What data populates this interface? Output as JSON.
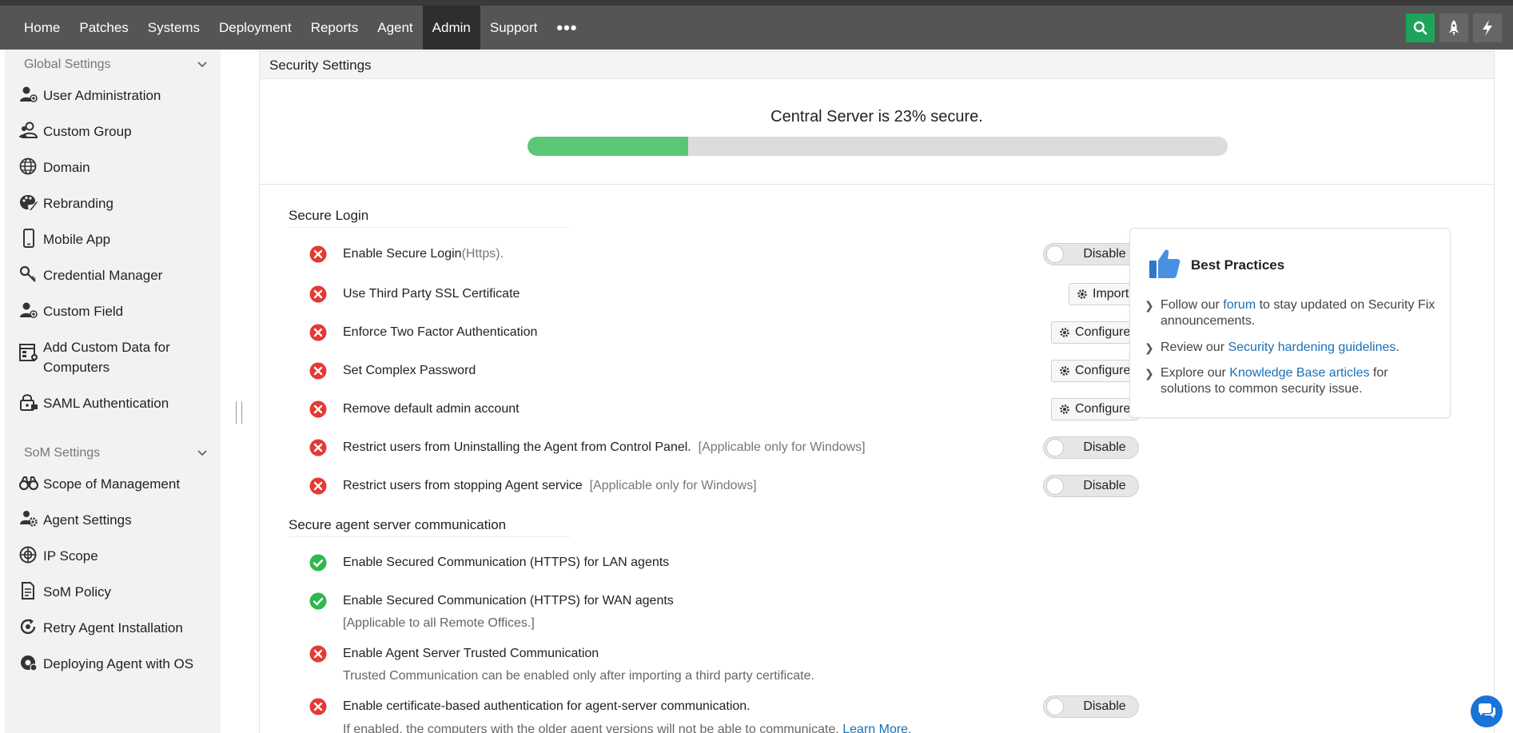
{
  "nav": {
    "items": [
      {
        "label": "Home",
        "active": false
      },
      {
        "label": "Patches",
        "active": false
      },
      {
        "label": "Systems",
        "active": false
      },
      {
        "label": "Deployment",
        "active": false
      },
      {
        "label": "Reports",
        "active": false
      },
      {
        "label": "Agent",
        "active": false
      },
      {
        "label": "Admin",
        "active": true
      },
      {
        "label": "Support",
        "active": false
      }
    ],
    "more": "•••",
    "right_icons": [
      "search-icon",
      "rocket-icon",
      "lightning-icon"
    ]
  },
  "sidebar": {
    "section1": "Global Settings",
    "global_items": [
      {
        "label": "User Administration",
        "icon": "user-admin-icon"
      },
      {
        "label": "Custom Group",
        "icon": "group-icon"
      },
      {
        "label": "Domain",
        "icon": "globe-icon"
      },
      {
        "label": "Rebranding",
        "icon": "palette-icon"
      },
      {
        "label": "Mobile App",
        "icon": "mobile-icon"
      },
      {
        "label": "Credential Manager",
        "icon": "keys-icon"
      },
      {
        "label": "Custom Field",
        "icon": "user-field-icon"
      },
      {
        "label": "Add Custom Data for Computers",
        "icon": "custom-data-icon"
      },
      {
        "label": "SAML Authentication",
        "icon": "saml-lock-icon"
      }
    ],
    "section2": "SoM Settings",
    "som_items": [
      {
        "label": "Scope of Management",
        "icon": "binoculars-icon"
      },
      {
        "label": "Agent Settings",
        "icon": "agent-gear-icon"
      },
      {
        "label": "IP Scope",
        "icon": "ip-scope-icon"
      },
      {
        "label": "SoM Policy",
        "icon": "policy-doc-icon"
      },
      {
        "label": "Retry Agent Installation",
        "icon": "retry-icon"
      },
      {
        "label": "Deploying Agent with OS",
        "icon": "deploy-os-icon"
      }
    ]
  },
  "panel": {
    "title": "Security Settings",
    "progress_text": "Central Server is 23% secure.",
    "progress_fraction": 0.23
  },
  "secure_login": {
    "title": "Secure Login",
    "rows": [
      {
        "text": "Enable Secure Login",
        "suffix": "(Https).",
        "status": "fail",
        "action": "toggle",
        "action_label": "Disable"
      },
      {
        "text": "Use Third Party SSL Certificate",
        "status": "fail",
        "action": "button",
        "action_label": "Import"
      },
      {
        "text": "Enforce Two Factor Authentication",
        "status": "fail",
        "action": "button",
        "action_label": "Configure"
      },
      {
        "text": "Set Complex Password",
        "status": "fail",
        "action": "button",
        "action_label": "Configure"
      },
      {
        "text": "Remove default admin account",
        "status": "fail",
        "action": "button",
        "action_label": "Configure"
      },
      {
        "text": "Restrict users from Uninstalling the Agent from Control Panel.",
        "suffix": "[Applicable only for Windows]",
        "status": "fail",
        "action": "toggle",
        "action_label": "Disable"
      },
      {
        "text": "Restrict users from stopping Agent service",
        "suffix": "[Applicable only for Windows]",
        "status": "fail",
        "action": "toggle",
        "action_label": "Disable"
      }
    ]
  },
  "secure_comm": {
    "title": "Secure agent server communication",
    "rows": [
      {
        "text": "Enable Secured Communication (HTTPS) for LAN agents",
        "status": "ok"
      },
      {
        "text": "Enable Secured Communication (HTTPS) for WAN agents",
        "sub": "[Applicable to all Remote Offices.]",
        "status": "ok"
      },
      {
        "text": "Enable Agent Server Trusted Communication",
        "sub": "Trusted Communication can be enabled only after importing a third party certificate.",
        "status": "fail"
      },
      {
        "text": "Enable certificate-based authentication for agent-server communication.",
        "sub": "If enabled, the computers with the older agent versions will not be able to communicate.",
        "sub_link": "Learn More.",
        "status": "fail",
        "action_label": "Disable"
      }
    ]
  },
  "best_practices": {
    "title": "Best Practices",
    "items": [
      {
        "pre": "Follow our ",
        "link": "forum",
        "post": " to stay updated on Security Fix announcements."
      },
      {
        "pre": "Review our ",
        "link": "Security hardening guidelines",
        "post": "."
      },
      {
        "pre": "Explore our ",
        "link": "Knowledge Base articles",
        "post": " for solutions to common security issue."
      }
    ]
  },
  "colors": {
    "nav_bg": "#555555",
    "nav_active": "#2e2e2e",
    "search_btn": "#1ea45a",
    "progress_fill": "#5bc676",
    "fail": "#e53935",
    "ok": "#2eb84d",
    "link": "#1b6fb5"
  }
}
